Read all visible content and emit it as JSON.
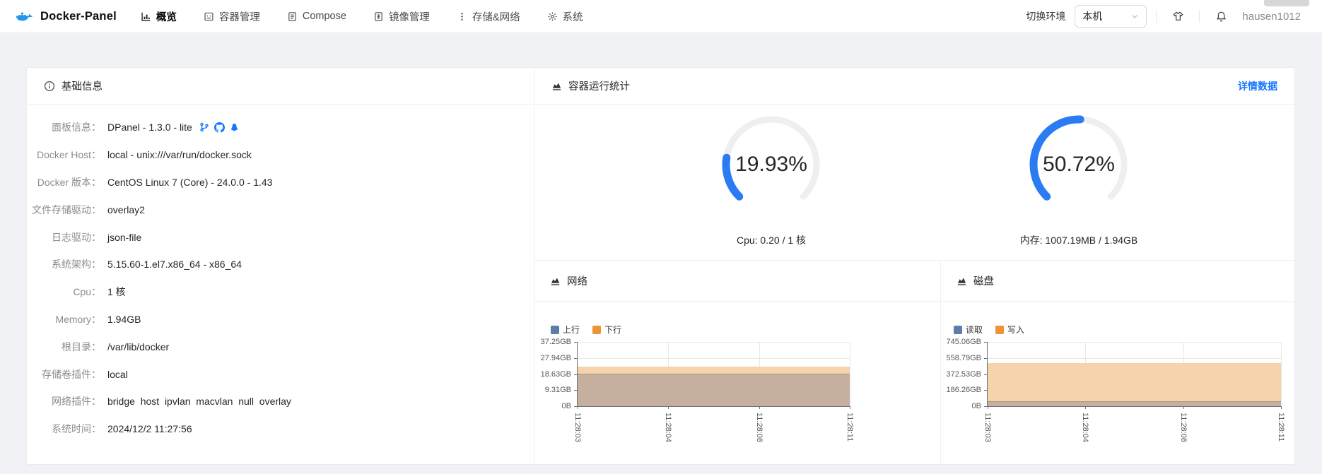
{
  "colors": {
    "accent_blue": "#1677ff",
    "gauge_blue": "#2b7bf3",
    "docker_blue": "#2496ed",
    "legend_blue": "#5b7da8",
    "legend_orange": "#ee9336",
    "area_orange_fill": "#f5d3ac",
    "area_blend_fill": "#c7af9f"
  },
  "navbar": {
    "brand": "Docker-Panel",
    "brand_icon": "docker-whale-icon",
    "menu": [
      {
        "label": "概览",
        "icon": "overview-chart-icon",
        "active": true
      },
      {
        "label": "容器管理",
        "icon": "container-icon",
        "active": false
      },
      {
        "label": "Compose",
        "icon": "compose-file-icon",
        "active": false
      },
      {
        "label": "镜像管理",
        "icon": "image-file-icon",
        "active": false
      },
      {
        "label": "存储&网络",
        "icon": "storage-network-dots-icon",
        "active": false
      },
      {
        "label": "系统",
        "icon": "system-gear-icon",
        "active": false
      }
    ],
    "env_switch_label": "切换环境",
    "env_selected": "本机",
    "right_icons": [
      "theme-tshirt-icon",
      "notification-bell-icon"
    ],
    "username": "hausen1012"
  },
  "info_card": {
    "title": "基础信息",
    "title_icon": "info-circle-icon",
    "label_suffix": "：",
    "rows": [
      {
        "label": "面板信息",
        "value": "DPanel - 1.3.0 - lite",
        "icons": [
          "git-branch-icon",
          "github-icon",
          "qq-penguin-icon"
        ]
      },
      {
        "label": "Docker Host",
        "value": "local - unix:///var/run/docker.sock"
      },
      {
        "label": "Docker 版本",
        "value": "CentOS Linux 7 (Core) - 24.0.0 - 1.43"
      },
      {
        "label": "文件存储驱动",
        "value": "overlay2"
      },
      {
        "label": "日志驱动",
        "value": "json-file"
      },
      {
        "label": "系统架构",
        "value": "5.15.60-1.el7.x86_64 - x86_64"
      },
      {
        "label": "Cpu",
        "value": "1 核"
      },
      {
        "label": "Memory",
        "value": "1.94GB"
      },
      {
        "label": "根目录",
        "value": "/var/lib/docker"
      },
      {
        "label": "存储卷插件",
        "value": "local"
      },
      {
        "label": "网络插件",
        "value": "bridge  host  ipvlan  macvlan  null  overlay"
      },
      {
        "label": "系统时间",
        "value": "2024/12/2 11:27:56"
      }
    ]
  },
  "stats_card": {
    "title": "容器运行统计",
    "title_icon": "area-chart-icon",
    "detail_link": "详情数据",
    "gauges": [
      {
        "percent": 19.93,
        "display": "19.93%",
        "label": "Cpu: 0.20 / 1 核",
        "color": "#2b7bf3",
        "track_color": "#efefef"
      },
      {
        "percent": 50.72,
        "display": "50.72%",
        "label": "内存: 1007.19MB / 1.94GB",
        "color": "#2b7bf3",
        "track_color": "#efefef"
      }
    ]
  },
  "chart_data": [
    {
      "type": "area",
      "title": "网络",
      "title_icon": "area-chart-icon",
      "legend": [
        "上行",
        "下行"
      ],
      "legend_position": "top-left",
      "grid": true,
      "x": [
        "11:28:03",
        "11:28:04",
        "11:28:08",
        "11:28:11"
      ],
      "y_ticks": [
        "37.25GB",
        "27.94GB",
        "18.63GB",
        "9.31GB",
        "0B"
      ],
      "ylim": [
        0,
        37.25
      ],
      "y_unit": "GB",
      "series": [
        {
          "name": "上行",
          "values": [
            18.6,
            18.6,
            18.6,
            18.6
          ],
          "marker_color": "#5b7da8",
          "area_fill": "#c7af9f"
        },
        {
          "name": "下行",
          "values": [
            23.0,
            23.0,
            23.0,
            23.0
          ],
          "marker_color": "#ee9336",
          "area_fill": "#f5d3ac"
        }
      ]
    },
    {
      "type": "area",
      "title": "磁盘",
      "title_icon": "area-chart-icon",
      "legend": [
        "读取",
        "写入"
      ],
      "legend_position": "top-left",
      "grid": true,
      "x": [
        "11:28:03",
        "11:28:04",
        "11:28:08",
        "11:28:11"
      ],
      "y_ticks": [
        "745.06GB",
        "558.79GB",
        "372.53GB",
        "186.26GB",
        "0B"
      ],
      "ylim": [
        0,
        745.06
      ],
      "y_unit": "GB",
      "series": [
        {
          "name": "读取",
          "values": [
            50,
            50,
            50,
            50
          ],
          "marker_color": "#5b7da8",
          "area_fill": "#c7af9f"
        },
        {
          "name": "写入",
          "values": [
            500,
            500,
            500,
            500
          ],
          "marker_color": "#ee9336",
          "area_fill": "#f5d3ac"
        }
      ]
    }
  ]
}
